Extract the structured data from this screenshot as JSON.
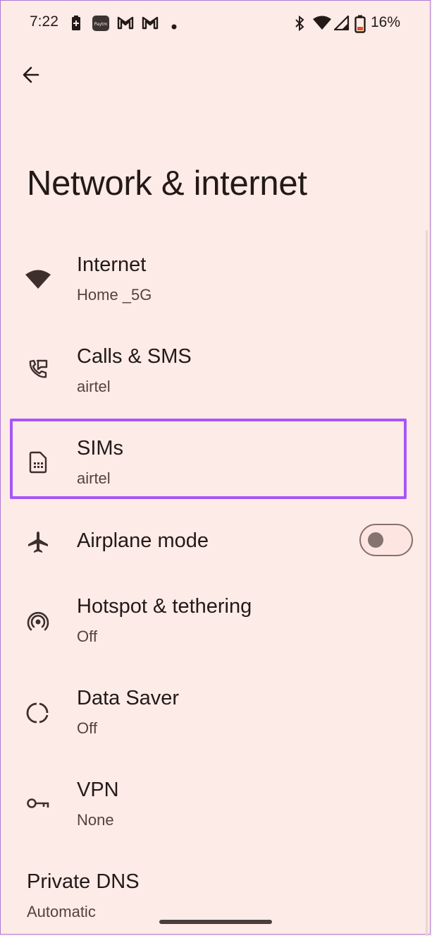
{
  "status_bar": {
    "time": "7:22",
    "battery_percent": "16%",
    "notification_icons": [
      "battery-saver-icon",
      "paytm-icon",
      "gmail-icon",
      "gmail-icon",
      "dot-icon"
    ],
    "system_icons": [
      "bluetooth-icon",
      "wifi-icon",
      "cell-signal-icon",
      "battery-icon"
    ]
  },
  "header": {
    "back_icon": "arrow-back-icon",
    "title": "Network & internet"
  },
  "items": [
    {
      "id": "internet",
      "icon": "wifi-icon",
      "title": "Internet",
      "subtitle": "Home _5G"
    },
    {
      "id": "calls-sms",
      "icon": "calls-sms-icon",
      "title": "Calls & SMS",
      "subtitle": "airtel"
    },
    {
      "id": "sims",
      "icon": "sim-card-icon",
      "title": "SIMs",
      "subtitle": "airtel",
      "highlighted": true
    },
    {
      "id": "airplane-mode",
      "icon": "airplane-icon",
      "title": "Airplane mode",
      "toggle_on": false
    },
    {
      "id": "hotspot",
      "icon": "hotspot-icon",
      "title": "Hotspot & tethering",
      "subtitle": "Off"
    },
    {
      "id": "data-saver",
      "icon": "data-saver-icon",
      "title": "Data Saver",
      "subtitle": "Off"
    },
    {
      "id": "vpn",
      "icon": "vpn-key-icon",
      "title": "VPN",
      "subtitle": "None"
    },
    {
      "id": "private-dns",
      "title": "Private DNS",
      "subtitle": "Automatic"
    }
  ],
  "colors": {
    "background": "#fdebe7",
    "highlight": "#a855f7",
    "text": "#231a18"
  }
}
